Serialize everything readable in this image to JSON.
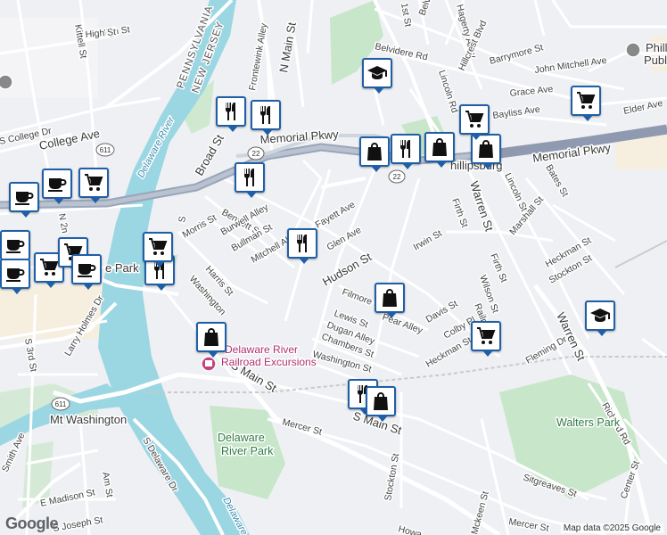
{
  "labels": {
    "streets": {
      "kittell": "Kittell St",
      "high": "High St",
      "college": "College Ave",
      "s_college": "S College Dr",
      "n_main": "N Main St",
      "belvidere_rd": "Belvidere Rd",
      "belvidere": "Belvide",
      "first": "1st St",
      "hagerty": "Hagerty Alley",
      "hillcrest": "Hillcrest Blvd",
      "barrymore": "Barrymore St",
      "john_mitchell": "John Mitchell Ave",
      "grace": "Grace Ave",
      "elder": "Elder Ave",
      "bayliss": "Bayliss Ave",
      "lincoln_rd": "Lincoln Rd",
      "memorial_w": "Memorial Pkwy",
      "memorial_e": "Memorial Pkwy",
      "broad": "Broad St",
      "bates": "Bates St",
      "lincoln": "Lincoln St",
      "warren": "Warren St",
      "warren2": "Warren St",
      "marshall": "Marshall St",
      "firth": "Firth St",
      "firth2": "Firth St",
      "bennett": "Bennett St",
      "morris": "Morris St",
      "burwell": "Burwell Alley",
      "bullman": "Bullman St",
      "mitchell": "Mitchell Al",
      "fayette": "Fayett Ave",
      "glen": "Glen Ave",
      "irwin": "Irwin St",
      "hudson": "Hudson St",
      "heckman": "Heckman St",
      "stockton_r": "Stockton St",
      "harris": "Harris St",
      "washington_v": "Washington",
      "filmore": "Filmore St",
      "pear": "Pear Alley",
      "davis": "Davis St",
      "wilson": "Wilson St",
      "colby": "Colby Pl",
      "railroad": "Railro",
      "heckman2": "Heckman St",
      "fleming": "Fleming Dr",
      "lewis": "Lewis St",
      "dugan": "Dugan Alley",
      "chambers": "Chambers St",
      "washington": "Washington St",
      "s_main": "S Main St",
      "s_main2": "S Main St",
      "mercer": "Mercer St",
      "mercer2": "Mercer St",
      "richard": "Richard Rd",
      "center": "Center St",
      "sitgreaves": "Sitgreaves St",
      "mckeen": "Mckeen St",
      "howard": "Howa",
      "stockton": "Stockton St",
      "s_3rd": "S 3rd St",
      "n_2nd": "N 2n",
      "larry_holmes": "Larry Holmes Dr",
      "smith": "Smith Ave",
      "s_delaware": "S Delaware Dr",
      "e_madison": "E Madison St",
      "s_joseph": "S Joseph St",
      "am": "Am St",
      "partial_tewink": "Frontewink Alley",
      "partial_s": "S",
      "partial_ir": "e Park",
      "partial_hps": "hillipsburg"
    },
    "areas": {
      "mt_washington": "Mt Washington",
      "walters_park": "Walters Park",
      "delaware_river_park_1": "Delaware",
      "delaware_river_park_2": "River Park",
      "phillipsburg_pub_1": "Phill",
      "phillipsburg_pub_2": "Publ",
      "excursions_1": "Delaware River",
      "excursions_2": "Railroad Excursions"
    },
    "state": {
      "pa": "PENNSYLVANIA",
      "nj": "NEW JERSEY"
    },
    "river": {
      "name1": "Delaware River",
      "name2": "Delaware River"
    },
    "highways": {
      "h611_a": "611",
      "h22_a": "22",
      "h22_b": "22",
      "h611_b": "611"
    }
  },
  "markers": [
    {
      "icon": "restaurant-icon",
      "name": "restaurant-marker-1"
    },
    {
      "icon": "restaurant-icon",
      "name": "restaurant-marker-2"
    },
    {
      "icon": "restaurant-icon",
      "name": "restaurant-marker-3"
    },
    {
      "icon": "restaurant-icon",
      "name": "restaurant-marker-4"
    },
    {
      "icon": "restaurant-icon",
      "name": "restaurant-marker-5"
    },
    {
      "icon": "restaurant-icon",
      "name": "restaurant-marker-6"
    },
    {
      "icon": "restaurant-icon",
      "name": "restaurant-marker-7"
    },
    {
      "icon": "shopping-bag-icon",
      "name": "shop-marker-1"
    },
    {
      "icon": "shopping-bag-icon",
      "name": "shop-marker-2"
    },
    {
      "icon": "shopping-bag-icon",
      "name": "shop-marker-3"
    },
    {
      "icon": "shopping-bag-icon",
      "name": "shop-marker-4"
    },
    {
      "icon": "shopping-bag-icon",
      "name": "shop-marker-5"
    },
    {
      "icon": "shopping-bag-icon",
      "name": "shop-marker-6"
    },
    {
      "icon": "shopping-cart-icon",
      "name": "grocery-marker-1"
    },
    {
      "icon": "shopping-cart-icon",
      "name": "grocery-marker-2"
    },
    {
      "icon": "shopping-cart-icon",
      "name": "grocery-marker-3"
    },
    {
      "icon": "shopping-cart-icon",
      "name": "grocery-marker-4"
    },
    {
      "icon": "shopping-cart-icon",
      "name": "grocery-marker-5"
    },
    {
      "icon": "shopping-cart-icon",
      "name": "grocery-marker-6"
    },
    {
      "icon": "shopping-cart-icon",
      "name": "grocery-marker-7"
    },
    {
      "icon": "coffee-icon",
      "name": "cafe-marker-1"
    },
    {
      "icon": "coffee-icon",
      "name": "cafe-marker-2"
    },
    {
      "icon": "coffee-icon",
      "name": "cafe-marker-3"
    },
    {
      "icon": "coffee-icon",
      "name": "cafe-marker-4"
    },
    {
      "icon": "coffee-icon",
      "name": "cafe-marker-5"
    },
    {
      "icon": "graduation-cap-icon",
      "name": "school-marker-1"
    },
    {
      "icon": "graduation-cap-icon",
      "name": "school-marker-2"
    }
  ],
  "attribution": "Map data ©2025 Google",
  "logo": "Google",
  "colors": {
    "water": "#9bd6e3",
    "park": "#c8e6c9",
    "marker_border": "#1f5fa8",
    "highway": "#9aa5b8",
    "poi": "#b0306f"
  }
}
